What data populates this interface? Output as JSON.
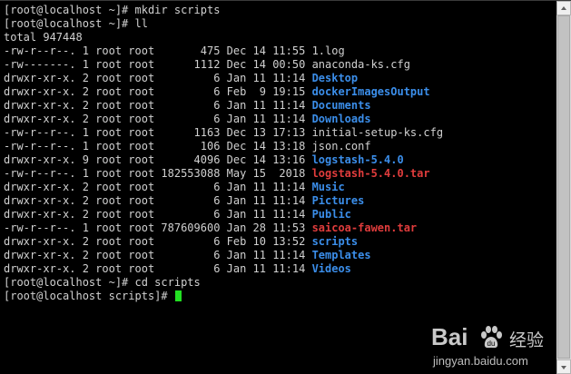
{
  "terminal": {
    "lines": [
      [
        {
          "text": "[root@localhost ~]# mkdir scripts",
          "style": "plain"
        }
      ],
      [
        {
          "text": "[root@localhost ~]# ll",
          "style": "plain"
        }
      ],
      [
        {
          "text": "total 947448",
          "style": "plain"
        }
      ],
      [
        {
          "text": "-rw-r--r--. 1 root root       475 Dec 14 11:55 ",
          "style": "plain"
        },
        {
          "text": "1.log",
          "style": "plain"
        }
      ],
      [
        {
          "text": "-rw-------. 1 root root      1112 Dec 14 00:50 ",
          "style": "plain"
        },
        {
          "text": "anaconda-ks.cfg",
          "style": "plain"
        }
      ],
      [
        {
          "text": "drwxr-xr-x. 2 root root         6 Jan 11 11:14 ",
          "style": "plain"
        },
        {
          "text": "Desktop",
          "style": "dir"
        }
      ],
      [
        {
          "text": "drwxr-xr-x. 2 root root         6 Feb  9 19:15 ",
          "style": "plain"
        },
        {
          "text": "dockerImagesOutput",
          "style": "dir"
        }
      ],
      [
        {
          "text": "drwxr-xr-x. 2 root root         6 Jan 11 11:14 ",
          "style": "plain"
        },
        {
          "text": "Documents",
          "style": "dir"
        }
      ],
      [
        {
          "text": "drwxr-xr-x. 2 root root         6 Jan 11 11:14 ",
          "style": "plain"
        },
        {
          "text": "Downloads",
          "style": "dir"
        }
      ],
      [
        {
          "text": "-rw-r--r--. 1 root root      1163 Dec 13 17:13 ",
          "style": "plain"
        },
        {
          "text": "initial-setup-ks.cfg",
          "style": "plain"
        }
      ],
      [
        {
          "text": "-rw-r--r--. 1 root root       106 Dec 14 13:18 ",
          "style": "plain"
        },
        {
          "text": "json.conf",
          "style": "plain"
        }
      ],
      [
        {
          "text": "drwxr-xr-x. 9 root root      4096 Dec 14 13:16 ",
          "style": "plain"
        },
        {
          "text": "logstash-5.4.0",
          "style": "dir"
        }
      ],
      [
        {
          "text": "-rw-r--r--. 1 root root 182553088 May 15  2018 ",
          "style": "plain"
        },
        {
          "text": "logstash-5.4.0.tar",
          "style": "archive"
        }
      ],
      [
        {
          "text": "drwxr-xr-x. 2 root root         6 Jan 11 11:14 ",
          "style": "plain"
        },
        {
          "text": "Music",
          "style": "dir"
        }
      ],
      [
        {
          "text": "drwxr-xr-x. 2 root root         6 Jan 11 11:14 ",
          "style": "plain"
        },
        {
          "text": "Pictures",
          "style": "dir"
        }
      ],
      [
        {
          "text": "drwxr-xr-x. 2 root root         6 Jan 11 11:14 ",
          "style": "plain"
        },
        {
          "text": "Public",
          "style": "dir"
        }
      ],
      [
        {
          "text": "-rw-r--r--. 1 root root 787609600 Jan 28 11:53 ",
          "style": "plain"
        },
        {
          "text": "saicoa-fawen.tar",
          "style": "archive"
        }
      ],
      [
        {
          "text": "drwxr-xr-x. 2 root root         6 Feb 10 13:52 ",
          "style": "plain"
        },
        {
          "text": "scripts",
          "style": "dir"
        }
      ],
      [
        {
          "text": "drwxr-xr-x. 2 root root         6 Jan 11 11:14 ",
          "style": "plain"
        },
        {
          "text": "Templates",
          "style": "dir"
        }
      ],
      [
        {
          "text": "drwxr-xr-x. 2 root root         6 Jan 11 11:14 ",
          "style": "plain"
        },
        {
          "text": "Videos",
          "style": "dir"
        }
      ],
      [
        {
          "text": "[root@localhost ~]# cd scripts",
          "style": "plain"
        }
      ]
    ],
    "prompt": "[root@localhost scripts]# ",
    "colors": {
      "background": "#000000",
      "text": "#d0d0d0",
      "directory": "#3b8eea",
      "archive": "#e03c3c",
      "cursor": "#22e022"
    }
  },
  "watermark": {
    "logo_text": "Bai",
    "brand_text": "经验",
    "url": "jingyan.baidu.com",
    "icon": "baidu-paw-icon"
  }
}
